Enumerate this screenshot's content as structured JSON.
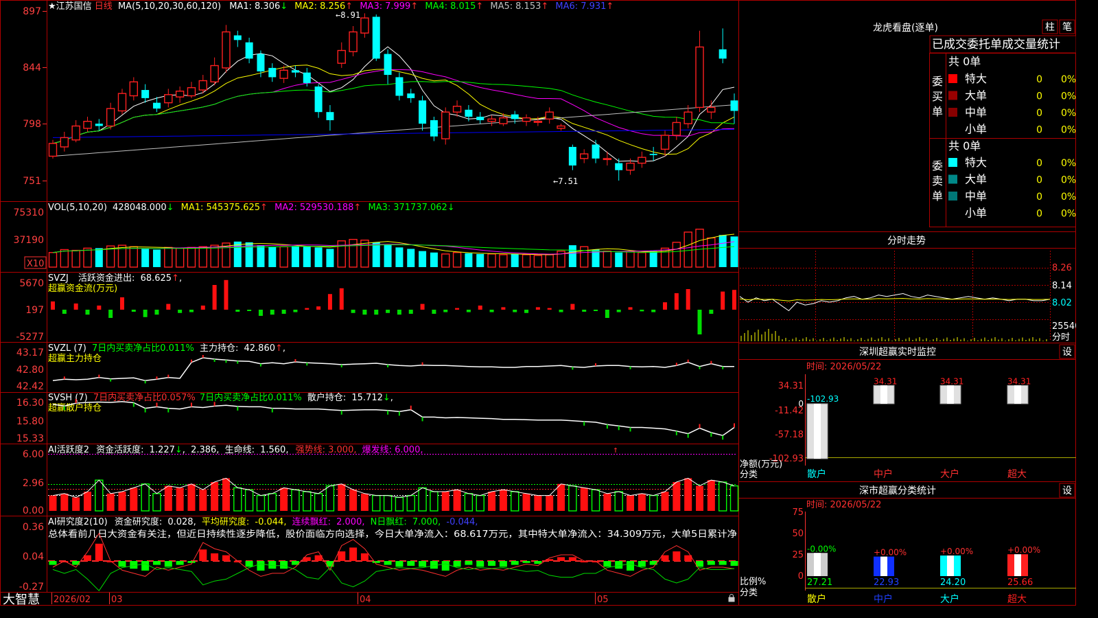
{
  "colors": {
    "up": "#ff2020",
    "down": "#00ffff",
    "frame": "#b00000",
    "bg": "#000000",
    "ma1": "#ffffff",
    "ma2": "#ffff00",
    "ma3": "#ff00ff",
    "ma4": "#00ff00",
    "ma5": "#c0c0c0",
    "ma6": "#0000ff"
  },
  "footer": {
    "app": "大智慧",
    "months": [
      "2026/02",
      "03",
      "04",
      "05"
    ]
  },
  "main": {
    "stock": "★江苏国信",
    "period": "日线",
    "ma_params": "MA(5,10,20,30,60,120)",
    "ma": [
      {
        "label": "MA1:",
        "value": "8.306",
        "arrow": "↓"
      },
      {
        "label": "MA2:",
        "value": "8.256",
        "arrow": "↑"
      },
      {
        "label": "MA3:",
        "value": "7.999",
        "arrow": "↑"
      },
      {
        "label": "MA4:",
        "value": "8.015",
        "arrow": "↑"
      },
      {
        "label": "MA5:",
        "value": "8.153",
        "arrow": "↑"
      },
      {
        "label": "MA6:",
        "value": "7.931",
        "arrow": "↑"
      }
    ],
    "axis": [
      "897",
      "844",
      "798",
      "751"
    ],
    "high_label": "8.91",
    "low_label": "7.51"
  },
  "vol": {
    "caption": "VOL(5,10,20)",
    "value": "428048.000",
    "arrow": "↓",
    "ma": [
      {
        "label": "MA1:",
        "value": "545375.625",
        "arrow": "↑"
      },
      {
        "label": "MA2:",
        "value": "529530.188",
        "arrow": "↑"
      },
      {
        "label": "MA3:",
        "value": "371737.062",
        "arrow": "↓"
      }
    ],
    "axis": [
      "75310",
      "37190"
    ],
    "unit": "X10"
  },
  "svzj": {
    "caption": "SVZJ",
    "active_label": "活跃资金进出:",
    "active_value": "68.625",
    "arrow": "↑",
    "subtitle": "超赢资金流(万元)",
    "axis": [
      "5670",
      "197",
      "-5277"
    ]
  },
  "svzl": {
    "caption": "SVZL (7)",
    "ratio_text": "7日内买卖净占比0.011%",
    "hold_label": "主力持仓:",
    "hold_value": "42.860",
    "arrow": "↑",
    "subtitle": "超赢主力持仓",
    "axis": [
      "43.17",
      "42.80",
      "42.42"
    ]
  },
  "svsh": {
    "caption": "SVSH (7)",
    "ratio_text1": "7日内买卖净占比0.057%",
    "ratio_text2": "7日内买卖净占比0.011%",
    "hold_label": "散户持仓:",
    "hold_value": "15.712",
    "arrow": "↓",
    "subtitle": "超赢散户持仓",
    "axis": [
      "16.30",
      "15.80",
      "15.33"
    ]
  },
  "ai1": {
    "caption": "AI活跃度2",
    "l1": "资金活跃度:",
    "v1": "1.227",
    "a1": "↓",
    "v2": "2.386",
    "l3": "生命线:",
    "v3": "1.560",
    "strong": "强势线: 3.000",
    "burst": "爆发线: 6.000",
    "axis": [
      "6.00",
      "2.96",
      "0.00"
    ]
  },
  "ai2": {
    "caption": "AI研究度2(10)",
    "l1": "资金研究度:",
    "v1": "0.028",
    "l2": "平均研究度:",
    "v2": "-0.044",
    "l3": "连续飘红:",
    "v3": "2.000",
    "l4": "N日飘红:",
    "v4": "7.000",
    "v5": "-0.044",
    "summary": "总体看前几日大资金有关注，但近日持续性逐步降低，股价面临方向选择，今日大单净流入：68.617万元，其中特大单净流入：34.309万元，大单5日累计净",
    "axis": [
      "0.36",
      "0.04",
      "-0.27"
    ]
  },
  "lhb": {
    "title": "龙虎看盘(逐单)",
    "btn1": "柱",
    "btn2": "笔",
    "tab": "已成交委托单成交量统计",
    "buy_total": "共 0单",
    "sell_total": "共 0单",
    "buy_side": "委买单",
    "sell_side": "委卖单",
    "rows": [
      {
        "name": "特大",
        "count": "0",
        "pct": "0%"
      },
      {
        "name": "大单",
        "count": "0",
        "pct": "0%"
      },
      {
        "name": "中单",
        "count": "0",
        "pct": "0%"
      },
      {
        "name": "小单",
        "count": "0",
        "pct": "0%"
      }
    ]
  },
  "fenshi": {
    "title": "分时走势",
    "axis": [
      "8.26",
      "8.14",
      "8.02",
      "25540"
    ],
    "unit": "分时"
  },
  "monitor": {
    "title": "深圳超赢实时监控",
    "btn": "设",
    "time": "时间: 2026/05/22",
    "axis": [
      "34.31",
      "-11.42",
      "-57.18",
      "-102.93",
      "0"
    ],
    "ylabel": "净额(万元)",
    "xlabel": "分类",
    "categories": [
      "散户",
      "中户",
      "大户",
      "超大"
    ],
    "bar_labels": [
      "-102.93",
      "34.31",
      "34.31",
      "34.31"
    ]
  },
  "classify": {
    "title": "深市超赢分类统计",
    "btn": "设",
    "time": "时间: 2026/05/22",
    "axis": [
      "75",
      "50",
      "25",
      "0"
    ],
    "ylabel": "比例%",
    "xlabel": "分类",
    "categories": [
      "散户",
      "中户",
      "大户",
      "超大"
    ],
    "top_labels": [
      "-0.00%",
      "+0.00%",
      "+0.00%",
      "+0.00%"
    ],
    "bottom_labels": [
      "27.21",
      "22.93",
      "24.20",
      "25.66"
    ]
  },
  "chart_data": {
    "type": "candlestick",
    "days": 60,
    "open": [
      7.72,
      7.8,
      7.86,
      7.96,
      8.0,
      7.98,
      8.11,
      8.24,
      8.29,
      8.18,
      8.18,
      8.23,
      8.24,
      8.29,
      8.36,
      8.48,
      8.76,
      8.7,
      8.6,
      8.48,
      8.39,
      8.46,
      8.44,
      8.32,
      8.1,
      8.52,
      8.62,
      8.78,
      8.92,
      8.6,
      8.4,
      8.26,
      8.2,
      8.03,
      7.87,
      8.1,
      8.12,
      8.06,
      8.02,
      8.0,
      8.08,
      8.02,
      8.02,
      8.04,
      7.96,
      7.8,
      7.7,
      7.82,
      7.7,
      7.66,
      7.6,
      7.66,
      7.74,
      7.78,
      7.9,
      8.0,
      8.14,
      8.1,
      8.64,
      8.2
    ],
    "close": [
      7.83,
      7.88,
      7.98,
      8.02,
      7.98,
      8.13,
      8.26,
      8.36,
      8.22,
      8.13,
      8.25,
      8.28,
      8.31,
      8.37,
      8.5,
      8.79,
      8.72,
      8.56,
      8.45,
      8.4,
      8.46,
      8.44,
      8.35,
      8.1,
      8.03,
      8.63,
      8.79,
      8.91,
      8.56,
      8.42,
      8.24,
      8.22,
      8.0,
      7.89,
      8.1,
      8.15,
      8.06,
      8.03,
      8.04,
      8.05,
      8.04,
      8.05,
      8.02,
      8.1,
      7.98,
      7.64,
      7.74,
      7.7,
      7.7,
      7.6,
      7.66,
      7.71,
      7.73,
      7.9,
      8.01,
      8.1,
      8.66,
      8.14,
      8.56,
      8.11
    ],
    "high": [
      7.86,
      7.93,
      8.03,
      8.06,
      8.04,
      8.18,
      8.3,
      8.4,
      8.34,
      8.23,
      8.3,
      8.32,
      8.36,
      8.42,
      8.57,
      8.85,
      8.8,
      8.74,
      8.63,
      8.52,
      8.5,
      8.5,
      8.48,
      8.34,
      8.16,
      8.7,
      8.84,
      8.95,
      8.94,
      8.64,
      8.44,
      8.3,
      8.24,
      8.06,
      8.14,
      8.2,
      8.16,
      8.1,
      8.07,
      8.09,
      8.11,
      8.08,
      8.06,
      8.14,
      8.0,
      7.82,
      7.78,
      7.86,
      7.76,
      7.7,
      7.7,
      7.76,
      7.8,
      7.94,
      8.06,
      8.16,
      8.8,
      8.2,
      8.82,
      8.26
    ],
    "low": [
      7.7,
      7.76,
      7.84,
      7.93,
      7.94,
      7.95,
      8.08,
      8.2,
      8.18,
      8.1,
      8.14,
      8.18,
      8.22,
      8.26,
      8.33,
      8.44,
      8.66,
      8.52,
      8.4,
      8.36,
      8.35,
      8.4,
      8.32,
      8.05,
      7.94,
      8.48,
      8.58,
      8.74,
      8.54,
      8.34,
      8.2,
      8.18,
      7.94,
      7.85,
      7.82,
      8.06,
      8.02,
      8.0,
      7.98,
      7.98,
      8.0,
      7.98,
      7.98,
      8.0,
      7.94,
      7.6,
      7.66,
      7.66,
      7.64,
      7.51,
      7.56,
      7.62,
      7.68,
      7.72,
      7.86,
      7.96,
      8.1,
      8.04,
      8.52,
      8.0
    ],
    "ylim": [
      7.4,
      9.1
    ],
    "volume": [
      20,
      24,
      23,
      26,
      26,
      29,
      30,
      28,
      25,
      24,
      27,
      26,
      27,
      28,
      30,
      33,
      35,
      34,
      30,
      28,
      28,
      29,
      28,
      27,
      25,
      36,
      38,
      37,
      34,
      31,
      27,
      25,
      22,
      20,
      18,
      20,
      19,
      18,
      18,
      17,
      18,
      17,
      16,
      17,
      22,
      30,
      28,
      24,
      22,
      20,
      21,
      20,
      22,
      26,
      34,
      48,
      52,
      40,
      44,
      42
    ],
    "svzj": [
      20,
      -10,
      15,
      -12,
      10,
      -20,
      30,
      -5,
      -18,
      -12,
      14,
      -8,
      -6,
      10,
      60,
      72,
      -5,
      -3,
      -15,
      -12,
      -10,
      -6,
      4,
      8,
      38,
      52,
      -8,
      -12,
      -12,
      -8,
      -12,
      -10,
      14,
      -10,
      -6,
      4,
      -6,
      10,
      -6,
      6,
      -6,
      -8,
      6,
      4,
      -6,
      14,
      -5,
      -3,
      -20,
      -6,
      6,
      -4,
      -6,
      18,
      40,
      50,
      -60,
      -10,
      44,
      48
    ],
    "svzl_line": [
      42.55,
      42.58,
      42.57,
      42.58,
      42.62,
      42.59,
      42.6,
      42.61,
      42.55,
      42.58,
      42.62,
      42.6,
      42.95,
      43.05,
      43.02,
      43.0,
      42.98,
      42.97,
      42.92,
      42.94,
      42.92,
      42.96,
      42.94,
      42.93,
      42.92,
      42.9,
      42.91,
      42.92,
      42.93,
      42.9,
      42.88,
      42.87,
      42.89,
      42.88,
      42.88,
      42.87,
      42.86,
      42.85,
      42.85,
      42.84,
      42.84,
      42.86,
      42.86,
      42.87,
      42.88,
      42.85,
      42.84,
      42.87,
      42.88,
      42.88,
      42.86,
      42.85,
      42.86,
      42.84,
      42.88,
      42.95,
      42.86,
      42.92,
      42.86,
      42.86
    ],
    "svsh_line": [
      16.25,
      16.2,
      16.28,
      16.3,
      16.31,
      16.3,
      16.32,
      16.29,
      16.14,
      16.18,
      16.14,
      16.12,
      16.18,
      16.16,
      16.2,
      16.22,
      16.19,
      16.18,
      16.18,
      16.14,
      16.14,
      16.12,
      16.12,
      16.12,
      16.1,
      16.08,
      16.09,
      16.1,
      16.1,
      16.08,
      16.05,
      16.1,
      15.9,
      15.9,
      15.88,
      15.89,
      15.88,
      15.87,
      15.86,
      15.84,
      15.84,
      15.83,
      15.82,
      15.82,
      15.82,
      15.8,
      15.78,
      15.76,
      15.7,
      15.66,
      15.62,
      15.62,
      15.6,
      15.58,
      15.52,
      15.45,
      15.6,
      15.48,
      15.4,
      15.62
    ],
    "ai_active": [
      0.8,
      0.9,
      0.7,
      1.0,
      1.6,
      0.9,
      1.0,
      1.2,
      1.4,
      0.9,
      1.3,
      1.2,
      1.4,
      1.1,
      1.5,
      1.7,
      1.2,
      1.1,
      0.8,
      0.9,
      1.2,
      1.1,
      1.0,
      0.9,
      1.3,
      1.4,
      1.1,
      0.9,
      0.8,
      0.8,
      0.7,
      0.8,
      1.2,
      1.0,
      1.0,
      1.1,
      0.9,
      0.8,
      1.0,
      1.1,
      1.0,
      0.9,
      0.8,
      0.8,
      1.4,
      1.3,
      1.2,
      1.1,
      0.9,
      1.0,
      0.8,
      0.9,
      0.8,
      1.0,
      1.5,
      1.7,
      1.3,
      1.6,
      1.5,
      1.3
    ],
    "ai_research": [
      -0.04,
      0.0,
      -0.04,
      0.06,
      0.18,
      0.0,
      -0.06,
      -0.08,
      -0.1,
      -0.04,
      -0.06,
      -0.04,
      -0.02,
      0.12,
      0.08,
      0.06,
      0.0,
      -0.06,
      -0.1,
      -0.08,
      -0.08,
      -0.04,
      0.04,
      0.06,
      -0.06,
      0.1,
      0.14,
      0.08,
      -0.02,
      -0.04,
      -0.06,
      -0.05,
      -0.06,
      -0.08,
      -0.1,
      -0.06,
      -0.04,
      -0.06,
      -0.05,
      -0.06,
      -0.04,
      -0.02,
      -0.03,
      0.02,
      0.04,
      0.04,
      0.0,
      0.0,
      -0.06,
      -0.08,
      -0.1,
      -0.06,
      -0.04,
      0.06,
      0.1,
      0.06,
      -0.06,
      -0.04,
      -0.04,
      -0.05
    ],
    "fenshi": [
      8.06,
      8.02,
      8.05,
      8.03,
      8.04,
      8.0,
      7.96,
      8.02,
      8.0,
      8.01,
      8.03,
      8.02,
      8.03,
      8.05,
      8.06,
      8.04,
      8.05,
      8.07,
      8.06,
      8.07,
      8.08,
      8.06,
      8.05,
      8.07,
      8.06,
      8.05,
      8.04,
      8.05,
      8.06,
      8.05,
      8.04,
      8.05,
      8.04,
      8.03,
      8.04,
      8.04,
      8.03,
      8.03,
      8.04
    ],
    "monitor_values": [
      -102.93,
      34.31,
      34.31,
      34.31
    ],
    "classify_values": [
      27.21,
      22.93,
      24.2,
      25.66
    ]
  }
}
